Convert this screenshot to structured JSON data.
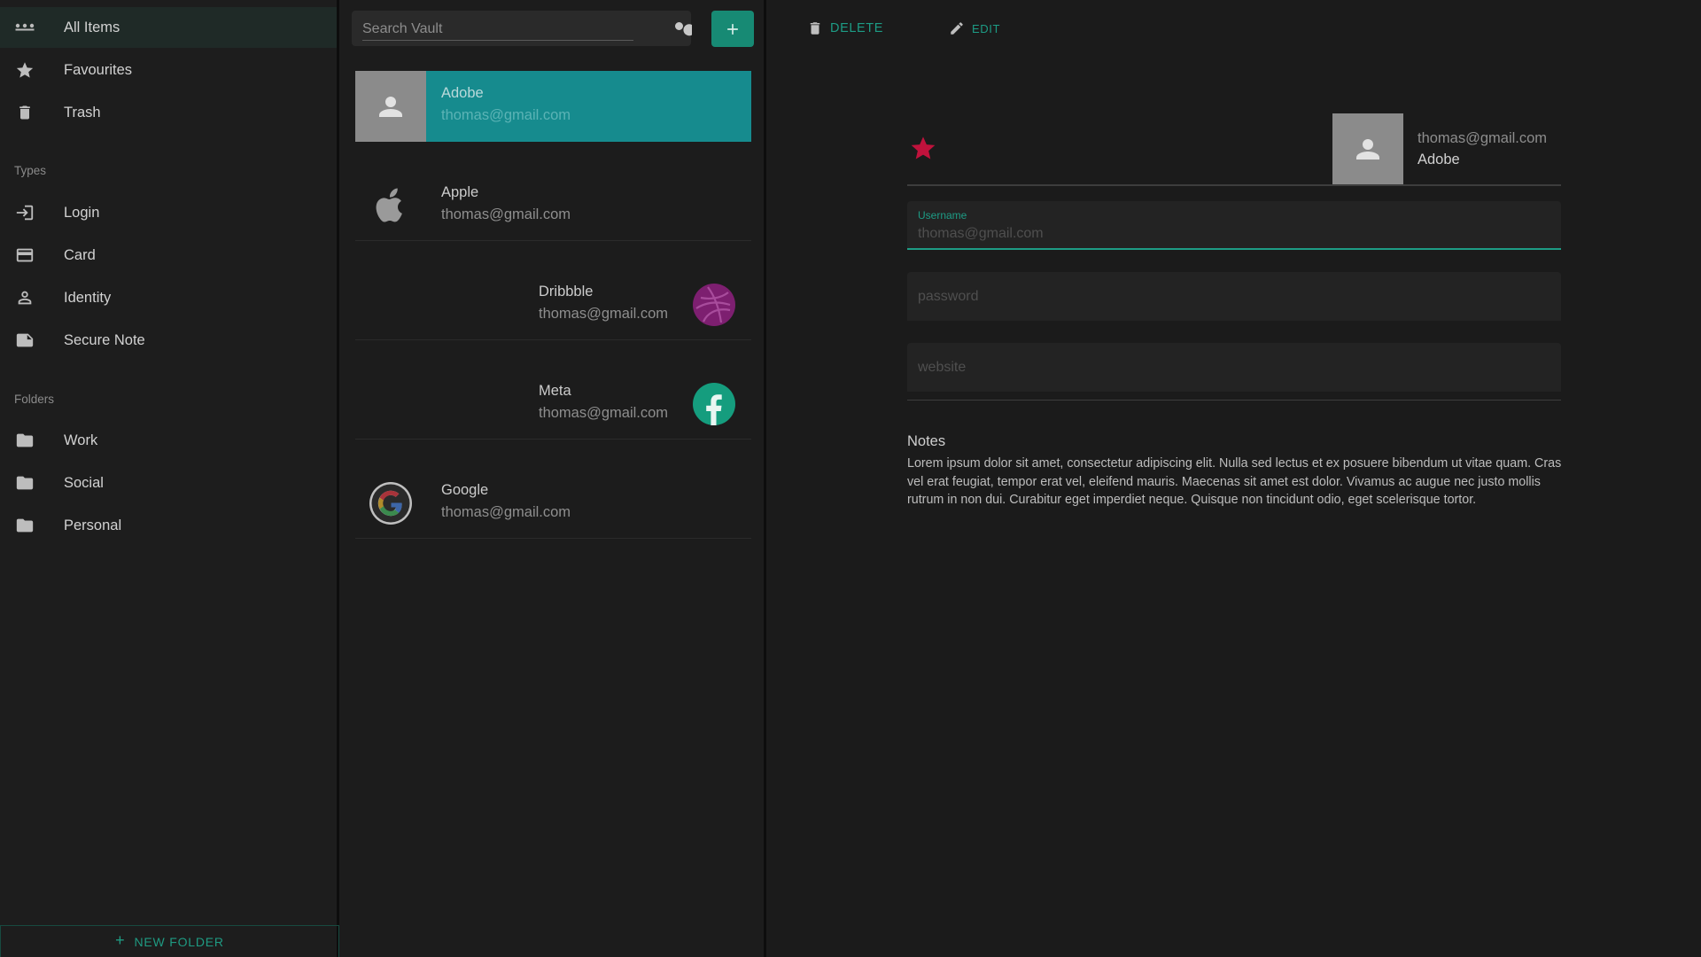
{
  "sidebar": {
    "items": [
      {
        "label": "All Items",
        "icon": "dots-icon",
        "active": true
      },
      {
        "label": "Favourites",
        "icon": "star-icon"
      },
      {
        "label": "Trash",
        "icon": "trash-icon"
      }
    ],
    "types_header": "Types",
    "types": [
      {
        "label": "Login",
        "icon": "login-icon"
      },
      {
        "label": "Card",
        "icon": "card-icon"
      },
      {
        "label": "Identity",
        "icon": "person-icon"
      },
      {
        "label": "Secure Note",
        "icon": "note-icon"
      }
    ],
    "folders_header": "Folders",
    "folders": [
      {
        "label": "Work",
        "icon": "folder-icon"
      },
      {
        "label": "Social",
        "icon": "folder-icon"
      },
      {
        "label": "Personal",
        "icon": "folder-icon"
      }
    ],
    "new_folder_label": "NEW FOLDER"
  },
  "search": {
    "placeholder": "Search Vault"
  },
  "vault_items": [
    {
      "name": "Adobe",
      "username": "thomas@gmail.com",
      "icon": "person-icon",
      "selected": true
    },
    {
      "name": "Apple",
      "username": "thomas@gmail.com",
      "icon": "apple-icon"
    },
    {
      "name": "Dribbble",
      "username": "thomas@gmail.com",
      "icon": "dribbble-icon"
    },
    {
      "name": "Meta",
      "username": "thomas@gmail.com",
      "icon": "facebook-icon"
    },
    {
      "name": "Google",
      "username": "thomas@gmail.com",
      "icon": "google-icon"
    }
  ],
  "detail": {
    "toolbar": {
      "delete_label": "DELETE",
      "edit_label": "EDIT"
    },
    "favourite": true,
    "email": "thomas@gmail.com",
    "name": "Adobe",
    "username_label": "Username",
    "username_value": "thomas@gmail.com",
    "password_placeholder": "password",
    "website_placeholder": "website",
    "notes_title": "Notes",
    "notes_body": "Lorem ipsum dolor sit amet, consectetur adipiscing elit. Nulla sed lectus et ex posuere bibendum ut vitae quam. Cras vel erat feugiat, tempor erat vel, eleifend mauris. Maecenas sit amet est dolor. Vivamus ac augue nec justo mollis rutrum in non dui. Curabitur eget imperdiet neque. Quisque non tincidunt odio, eget scelerisque tortor."
  },
  "colors": {
    "accent": "#1d9c85",
    "selected_item": "#168b8e",
    "favourite_star": "#c0123c",
    "dribbble": "#7d1f70",
    "facebook": "#159d7e"
  }
}
